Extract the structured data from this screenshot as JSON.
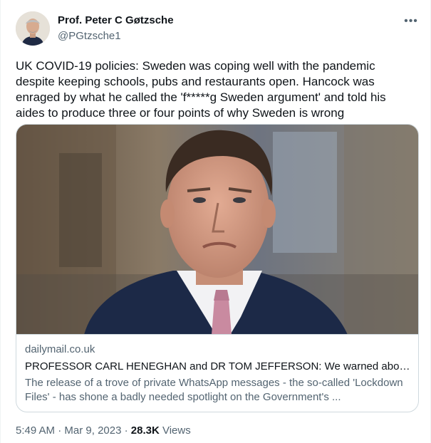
{
  "author": {
    "name": "Prof. Peter C Gøtzsche",
    "handle": "@PGtzsche1",
    "avatar_icon": "person-portrait-icon"
  },
  "more_icon": "more-horizontal-icon",
  "more_glyph": "•••",
  "tweet_text": "UK COVID-19 policies: Sweden was coping well with the pandemic despite keeping schools, pubs and restaurants open. Hancock was enraged by what he called the 'f*****g Sweden argument' and told his aides to produce three or four points of why Sweden is wrong",
  "link_card": {
    "domain": "dailymail.co.uk",
    "title": "PROFESSOR CARL HENEGHAN and DR TOM JEFFERSON: We warned about l...",
    "description": "The release of a trove of private WhatsApp messages - the so-called 'Lockdown Files' - has shone a badly needed spotlight on the Government's ...",
    "image_icon": "news-photo-man-in-suit"
  },
  "meta": {
    "time": "5:49 AM",
    "separator": "·",
    "date": "Mar 9, 2023",
    "views_count": "28.3K",
    "views_label": "Views"
  }
}
